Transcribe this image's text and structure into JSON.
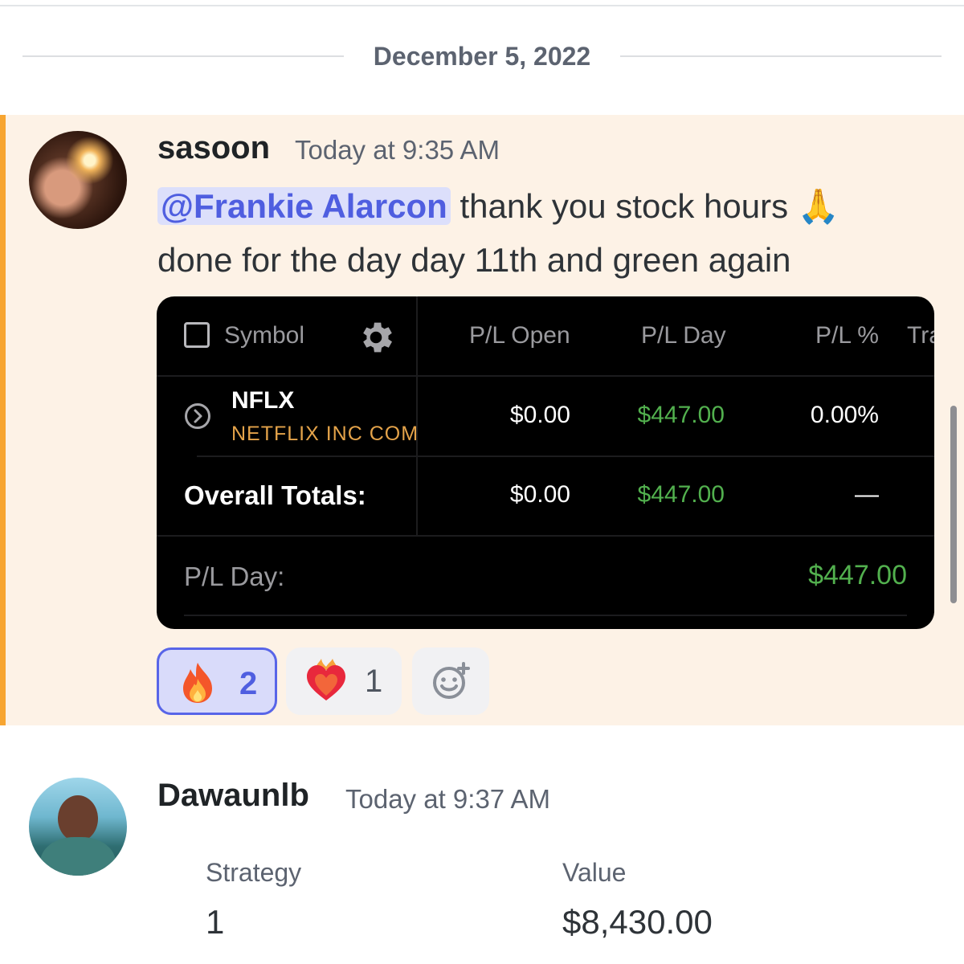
{
  "date_divider": "December 5, 2022",
  "messages": [
    {
      "username": "sasoon",
      "timestamp": "Today at 9:35 AM",
      "mention": "@Frankie Alarcon",
      "text_line1": " thank you stock hours ",
      "emoji": "🙏",
      "text_line2": "done for the day day 11th and green again",
      "embed": {
        "headers": {
          "symbol": "Symbol",
          "pl_open": "P/L Open",
          "pl_day": "P/L Day",
          "pl_pct": "P/L %",
          "trade_cut": "Tra"
        },
        "row": {
          "symbol": "NFLX",
          "name": "NETFLIX INC COM",
          "pl_open": "$0.00",
          "pl_day": "$447.00",
          "pl_pct": "0.00%"
        },
        "totals": {
          "label": "Overall Totals:",
          "pl_open": "$0.00",
          "pl_day": "$447.00",
          "pl_pct": "—"
        },
        "footer": {
          "label": "P/L Day:",
          "value": "$447.00"
        }
      },
      "reactions": [
        {
          "emoji": "fire-emoji",
          "count": "2",
          "active": true
        },
        {
          "emoji": "heart-on-fire-emoji",
          "count": "1",
          "active": false
        }
      ]
    },
    {
      "username": "Dawaunlb",
      "timestamp": "Today at 9:37 AM",
      "table": {
        "headers": [
          "Strategy",
          "Value"
        ],
        "values": [
          "1",
          "$8,430.00"
        ]
      }
    }
  ],
  "colors": {
    "mention_bg": "#dcdffb",
    "mention_text": "#4f5ee0",
    "highlight_bar": "#f7a531",
    "highlight_bg": "#fdf2e6",
    "profit_green": "#52b04e"
  }
}
